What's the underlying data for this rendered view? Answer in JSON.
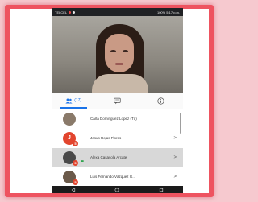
{
  "status_bar": {
    "left_text": "TELCEL",
    "right_text": "100% 5:17 p.m."
  },
  "tabs": [
    {
      "label": "(17)",
      "icon": "people-icon",
      "active": true
    },
    {
      "label": "",
      "icon": "chat-icon",
      "active": false
    },
    {
      "label": "",
      "icon": "info-icon",
      "active": false
    }
  ],
  "participants": [
    {
      "name": "Carla Dominguez Lopez (Tú)",
      "avatar_letter": "",
      "avatar_color": "#8a7a6a",
      "badge": "",
      "chevron": ""
    },
    {
      "name": "Jesus Rojas Flores",
      "avatar_letter": "J",
      "avatar_color": "#e2452e",
      "badge": "5",
      "chevron": ">"
    },
    {
      "name": "Alexa Casasola Arcate",
      "avatar_letter": "",
      "avatar_color": "#4a4a4a",
      "badge": "5",
      "chevron": ">"
    },
    {
      "name": "Luis Fernando Vázquez G...",
      "avatar_letter": "",
      "avatar_color": "#6b5a4a",
      "badge": "5",
      "chevron": ">"
    }
  ],
  "colors": {
    "frame": "#ee5360",
    "accent": "#1a73e8",
    "badge": "#e2452e",
    "speaking": "#2aa34a"
  }
}
